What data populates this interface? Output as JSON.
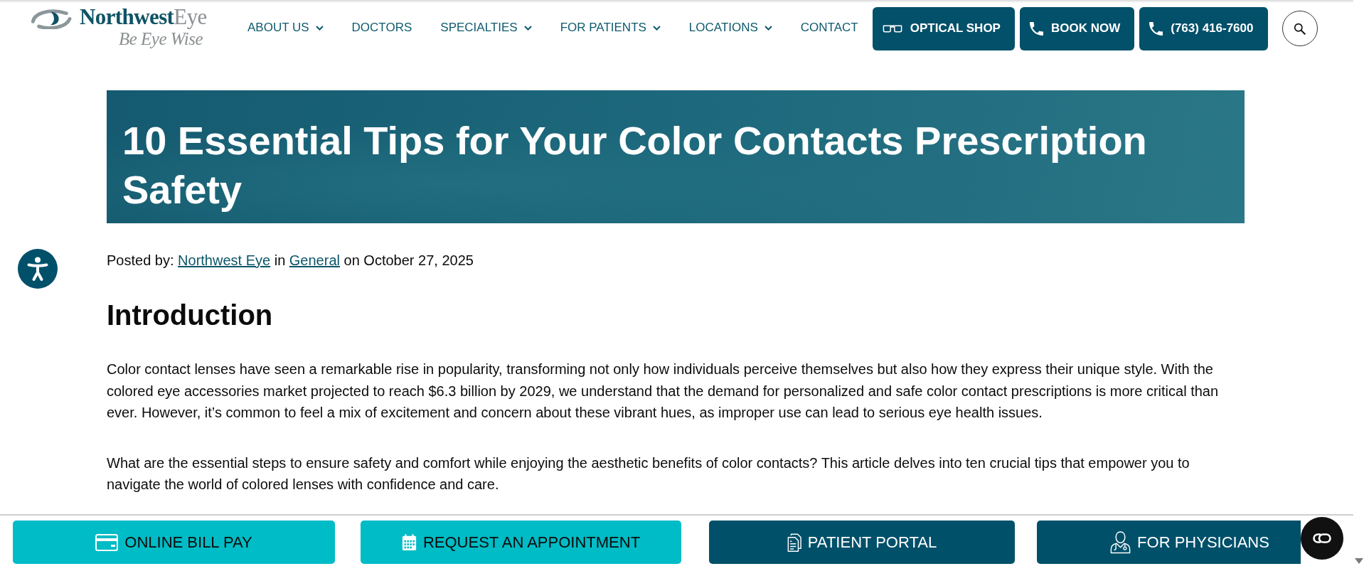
{
  "header": {
    "logo": {
      "wordmark_parts": [
        "Northwest",
        "Eye"
      ],
      "tagline": "Be Eye Wise"
    },
    "nav": [
      {
        "label": "ABOUT US",
        "has_dropdown": true
      },
      {
        "label": "DOCTORS",
        "has_dropdown": false
      },
      {
        "label": "SPECIALTIES",
        "has_dropdown": true
      },
      {
        "label": "FOR PATIENTS",
        "has_dropdown": true
      },
      {
        "label": "LOCATIONS",
        "has_dropdown": true
      },
      {
        "label": "CONTACT",
        "has_dropdown": false
      }
    ],
    "actions": [
      {
        "label": "OPTICAL SHOP",
        "kind": "shop"
      },
      {
        "label": "BOOK NOW",
        "kind": "booking"
      },
      {
        "label": "(763) 416-7600",
        "kind": "call"
      }
    ]
  },
  "article": {
    "title": "10 Essential Tips for Your Color Contacts Prescription Safety",
    "meta": {
      "prefix": "Posted by:",
      "author": "Northwest Eye",
      "joiner": "in",
      "category": "General",
      "date": "on October 27, 2025"
    },
    "heading": "Introduction",
    "paragraphs": [
      "Color contact lenses have seen a remarkable rise in popularity, transforming not only how individuals perceive themselves but also how they express their unique style. With the colored eye accessories market projected to reach $6.3 billion by 2029, we understand that the demand for personalized and safe color contact prescriptions is more critical than ever. However, it’s common to feel a mix of excitement and concern about these vibrant hues, as improper use can lead to serious eye health issues.",
      "What are the essential steps to ensure safety and comfort while enjoying the aesthetic benefits of color contacts? This article delves into ten crucial tips that empower you to navigate the world of colored lenses with confidence and care."
    ]
  },
  "bottom_bar": [
    {
      "label": "ONLINE BILL PAY",
      "kind": "billing",
      "color": "#00bcc6"
    },
    {
      "label": "REQUEST AN APPOINTMENT",
      "kind": "appointment",
      "color": "#00bcc6"
    },
    {
      "label": "PATIENT PORTAL",
      "kind": "portal",
      "color": "#00506a"
    },
    {
      "label": "FOR PHYSICIANS",
      "kind": "physicians",
      "color": "#00506a"
    }
  ]
}
